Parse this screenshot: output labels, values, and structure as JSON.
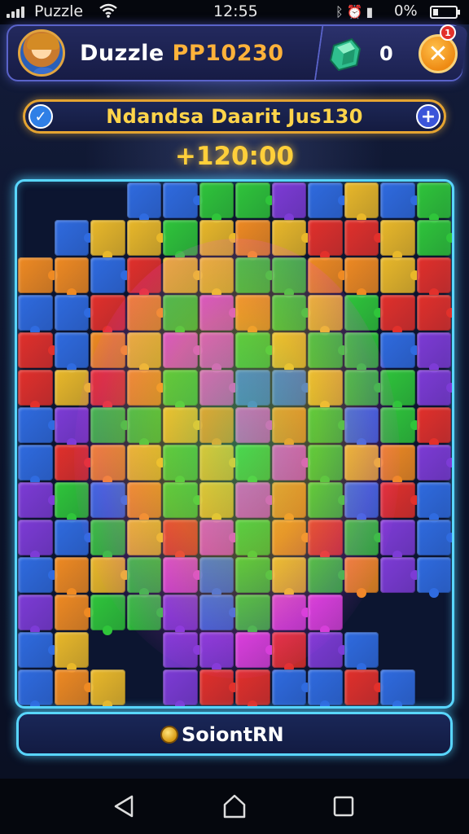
{
  "status_bar": {
    "app_name": "Puzzle",
    "time": "12:55",
    "battery_text": "0%",
    "icons": [
      "signal-icon",
      "wifi-icon",
      "bluetooth-icon",
      "alarm-icon",
      "battery-icon"
    ]
  },
  "header": {
    "player_name": "Duzzle",
    "player_id": "PP10230",
    "gem_count": "0",
    "close_badge": "1"
  },
  "goal": {
    "text": "Ndandsa Daarit Jus130",
    "check_symbol": "✓",
    "plus_symbol": "+"
  },
  "timer": "+120:00",
  "solve_button": {
    "label": "SoiontRN"
  },
  "colors": {
    "blue": "#2f6be0",
    "green": "#2fc53a",
    "yellow": "#e9b829",
    "orange": "#ef8a22",
    "red": "#e2302b",
    "purple": "#7d3bd6",
    "magenta": "#d33fd6",
    "accent_cyan": "#59d6ff",
    "accent_gold": "#e5a431"
  },
  "board": {
    "cols": 12,
    "rows": 14,
    "colors": [
      "EEEBBGGPBYBG",
      "EBYYGYOYRRYG",
      "OOBRYYGGOOYR",
      "BBROGMOGYGRR",
      "RBOYMMGYGGBP",
      "RYROGMBBYGGP",
      "BPGGYOMOGBGR",
      "BROYGYGMGYOP",
      "PGBOGYMOGBRB",
      "PBGYRMGORGPB",
      "BOYGMBGYGOPB",
      "POGGPBGMMEEE",
      "BYEEPPMRPBEE",
      "BOYEPRRBBRBE"
    ]
  }
}
